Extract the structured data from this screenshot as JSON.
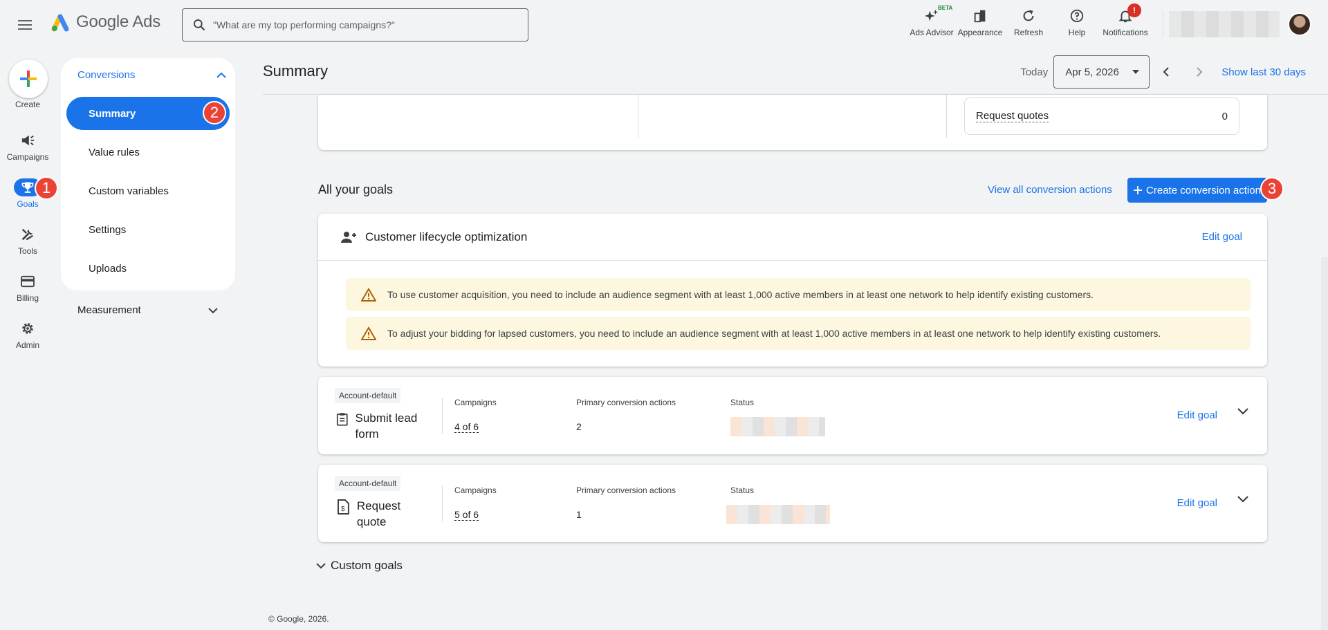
{
  "app": {
    "name": "Google Ads"
  },
  "search": {
    "placeholder": "\"What are my top performing campaigns?\""
  },
  "top_actions": [
    {
      "label": "Ads Advisor",
      "icon": "sparkle-icon",
      "badge": "BETA"
    },
    {
      "label": "Appearance",
      "icon": "appearance-icon"
    },
    {
      "label": "Refresh",
      "icon": "refresh-icon"
    },
    {
      "label": "Help",
      "icon": "help-icon"
    },
    {
      "label": "Notifications",
      "icon": "bell-icon",
      "badge": "!"
    }
  ],
  "rail": {
    "create_label": "Create",
    "items": [
      {
        "label": "Campaigns",
        "icon": "megaphone-icon"
      },
      {
        "label": "Goals",
        "icon": "trophy-icon",
        "active": true
      },
      {
        "label": "Tools",
        "icon": "tools-icon"
      },
      {
        "label": "Billing",
        "icon": "credit-card-icon"
      },
      {
        "label": "Admin",
        "icon": "gear-icon"
      }
    ]
  },
  "subnav": {
    "section": "Conversions",
    "items": [
      "Summary",
      "Value rules",
      "Custom variables",
      "Settings",
      "Uploads"
    ],
    "active": "Summary",
    "collapsed_section": "Measurement"
  },
  "steps": [
    "1",
    "2",
    "3"
  ],
  "header": {
    "title": "Summary",
    "today_label": "Today",
    "date": "Apr 5, 2026",
    "show_last": "Show last 30 days"
  },
  "top_card": {
    "quote_label": "Request quotes",
    "quote_value": "0"
  },
  "goals": {
    "title": "All your goals",
    "view_all": "View all conversion actions",
    "create_button": "Create conversion action",
    "lifecycle": {
      "title": "Customer lifecycle optimization",
      "edit": "Edit goal",
      "warnings": [
        "To use customer acquisition, you need to include an audience segment with at least 1,000 active members in at least one network to help identify existing customers.",
        "To adjust your bidding for lapsed customers, you need to include an audience segment with at least 1,000 active members in at least one network to help identify existing customers."
      ]
    },
    "columns": {
      "campaigns": "Campaigns",
      "primary": "Primary conversion actions",
      "status": "Status"
    },
    "items": [
      {
        "tag": "Account-default",
        "name": "Submit lead form",
        "icon": "clipboard-icon",
        "campaigns": "4 of 6",
        "primary": "2",
        "edit": "Edit goal"
      },
      {
        "tag": "Account-default",
        "name": "Request quote",
        "icon": "quote-doc-icon",
        "campaigns": "5 of 6",
        "primary": "1",
        "edit": "Edit goal"
      }
    ],
    "custom_goals": "Custom goals"
  },
  "footer": "© Google, 2026."
}
